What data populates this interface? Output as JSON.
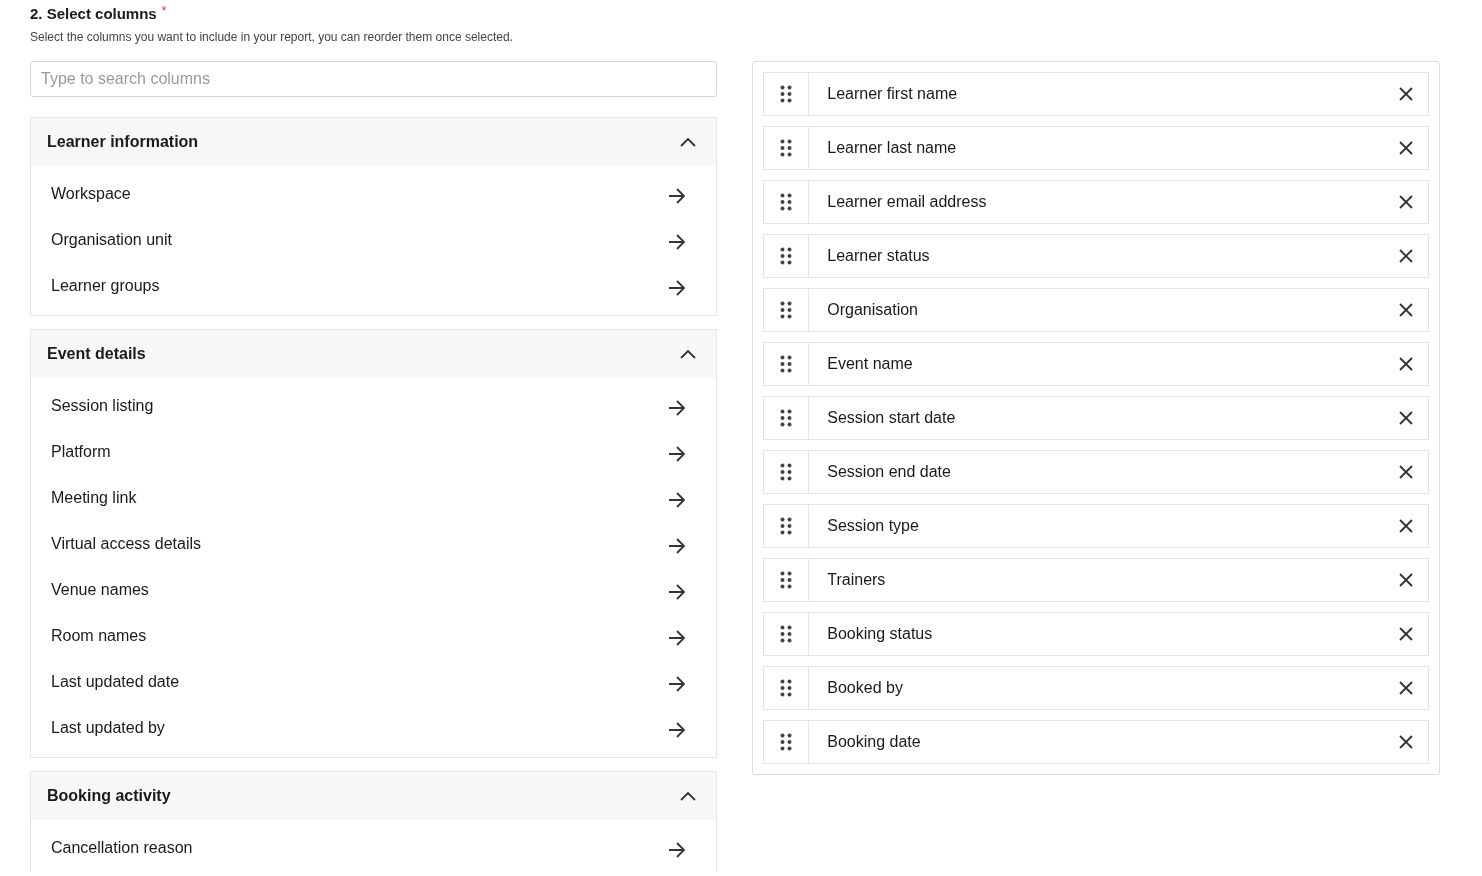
{
  "heading": {
    "title": "2. Select columns",
    "required_mark": "*",
    "description": "Select the columns you want to include in your report, you can reorder them once selected."
  },
  "search": {
    "placeholder": "Type to search columns"
  },
  "groups": [
    {
      "title": "Learner information",
      "expanded": true,
      "items": [
        "Workspace",
        "Organisation unit",
        "Learner groups"
      ]
    },
    {
      "title": "Event details",
      "expanded": true,
      "items": [
        "Session listing",
        "Platform",
        "Meeting link",
        "Virtual access details",
        "Venue names",
        "Room names",
        "Last updated date",
        "Last updated by"
      ]
    },
    {
      "title": "Booking activity",
      "expanded": true,
      "items": [
        "Cancellation reason"
      ]
    }
  ],
  "selected_columns": [
    "Learner first name",
    "Learner last name",
    "Learner email address",
    "Learner status",
    "Organisation",
    "Event name",
    "Session start date",
    "Session end date",
    "Session type",
    "Trainers",
    "Booking status",
    "Booked by",
    "Booking date"
  ]
}
